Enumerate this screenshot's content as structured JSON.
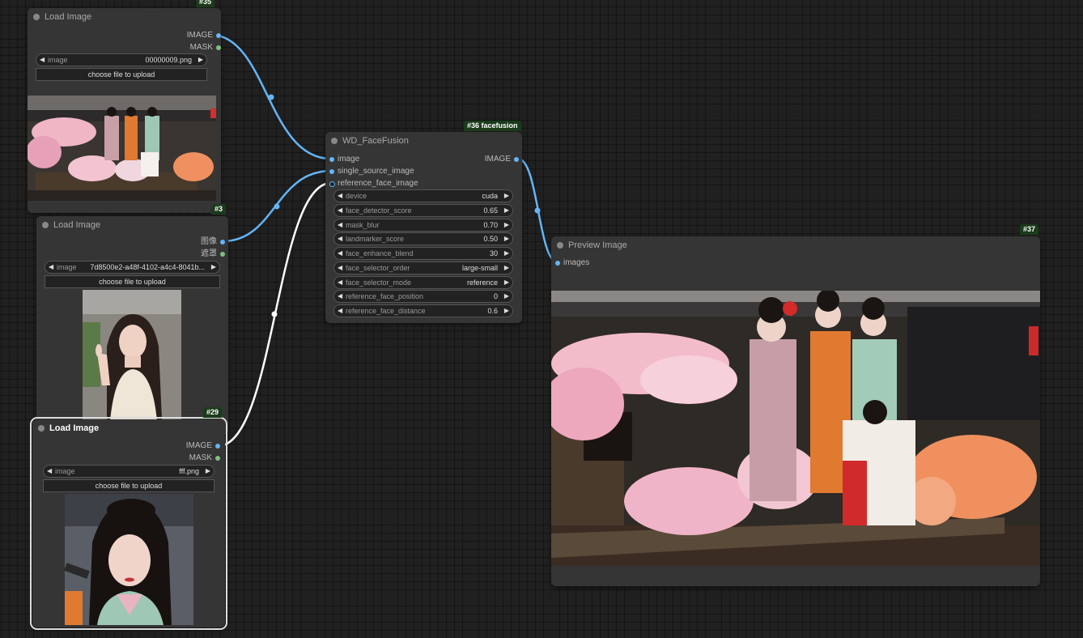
{
  "nodes": {
    "load35": {
      "id": "#35",
      "title": "Load Image",
      "outputs": [
        "IMAGE",
        "MASK"
      ],
      "widget": {
        "name": "image",
        "value": "00000009.png"
      },
      "upload_label": "choose file to upload"
    },
    "load3": {
      "id": "#3",
      "title": "Load Image",
      "outputs": [
        "图像",
        "遮罩"
      ],
      "widget": {
        "name": "image",
        "value": "7d8500e2-a48f-4102-a4c4-8041b..."
      },
      "upload_label": "choose file to upload"
    },
    "load29": {
      "id": "#29",
      "title": "Load Image",
      "outputs": [
        "IMAGE",
        "MASK"
      ],
      "widget": {
        "name": "image",
        "value": "fff.png"
      },
      "upload_label": "choose file to upload"
    },
    "facefusion": {
      "id": "#36 facefusion",
      "title": "WD_FaceFusion",
      "inputs": [
        "image",
        "single_source_image",
        "reference_face_image"
      ],
      "output": "IMAGE",
      "widgets": [
        {
          "name": "device",
          "value": "cuda"
        },
        {
          "name": "face_detector_score",
          "value": "0.65"
        },
        {
          "name": "mask_blur",
          "value": "0.70"
        },
        {
          "name": "landmarker_score",
          "value": "0.50"
        },
        {
          "name": "face_enhance_blend",
          "value": "30"
        },
        {
          "name": "face_selector_order",
          "value": "large-small"
        },
        {
          "name": "face_selector_mode",
          "value": "reference"
        },
        {
          "name": "reference_face_position",
          "value": "0"
        },
        {
          "name": "reference_face_distance",
          "value": "0.6"
        }
      ]
    },
    "preview": {
      "id": "#37",
      "title": "Preview Image",
      "input": "images"
    }
  },
  "colors": {
    "canvas": "#202020",
    "node_body": "#353535",
    "node_id_badge": "#1b3b1b",
    "link_image": "#64b5f6",
    "link_selected": "#ffffff",
    "slot_mask": "#7fc07f"
  }
}
